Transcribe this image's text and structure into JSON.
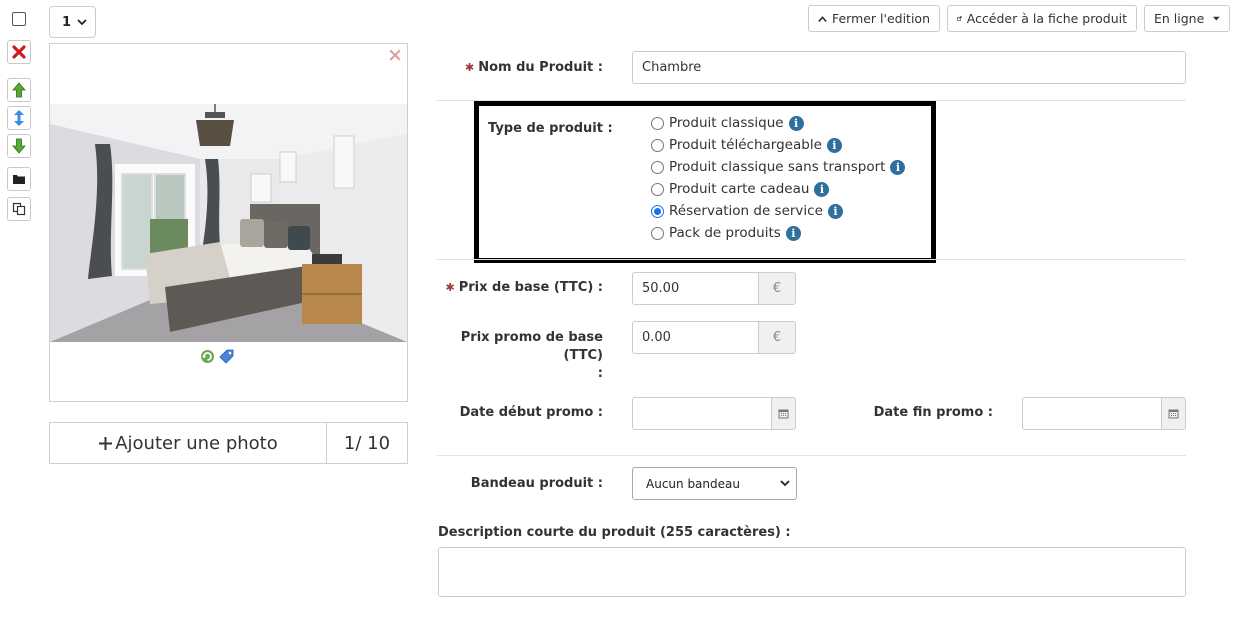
{
  "toolbar_left": {
    "icons": [
      "checkbox-icon",
      "delete-icon",
      "move-up-icon",
      "move-updown-icon",
      "move-down-icon",
      "folder-icon",
      "duplicate-icon"
    ]
  },
  "quantity": {
    "value": "1"
  },
  "photo": {
    "close_icon": "×",
    "add_label": "Ajouter une photo",
    "count": "1/ 10"
  },
  "top_buttons": {
    "close_edit": "Fermer l'edition",
    "open_product": "Accéder à la fiche produit",
    "status": "En ligne"
  },
  "form": {
    "name_label": "Nom du Produit :",
    "name_value": "Chambre",
    "type_label": "Type de produit :",
    "types": [
      {
        "label": "Produit classique",
        "checked": false
      },
      {
        "label": "Produit téléchargeable",
        "checked": false
      },
      {
        "label": "Produit classique sans transport",
        "checked": false
      },
      {
        "label": "Produit carte cadeau",
        "checked": false
      },
      {
        "label": "Réservation de service",
        "checked": true
      },
      {
        "label": "Pack de produits",
        "checked": false
      }
    ],
    "price_label": "Prix de base (TTC) :",
    "price_value": "50.00",
    "currency": "€",
    "promo_label_1": "Prix promo de base",
    "promo_label_2": "(TTC)",
    "promo_label_3": ":",
    "promo_value": "0.00",
    "promo_start_label": "Date début promo :",
    "promo_end_label": "Date fin promo :",
    "banner_label": "Bandeau produit :",
    "banner_value": "Aucun bandeau",
    "desc_label": "Description courte du produit (255 caractères) :",
    "desc_value": ""
  },
  "colors": {
    "accent": "#1a73e8",
    "info": "#2e6f9e",
    "required_star": "#9b3b3b",
    "delete_red": "#d11a1a",
    "arrow_green": "#4c9a2a"
  }
}
